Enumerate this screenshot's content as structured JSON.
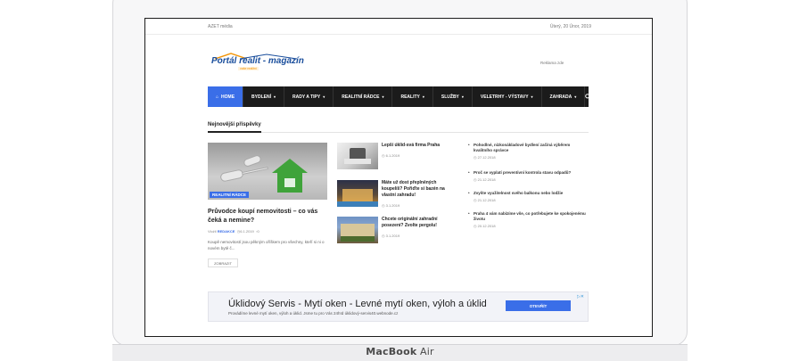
{
  "device": {
    "brand_name": "MacBook",
    "brand_model": "Air"
  },
  "topbar": {
    "left": "AZET média",
    "right": "Úterý, 20 Únor, 2019"
  },
  "header": {
    "logo_text": "Portál realit - magazín",
    "logo_tagline": "vaše realitní",
    "ad_label": "Reklama zde"
  },
  "nav": {
    "items": [
      {
        "label": "HOME",
        "active": true,
        "dropdown": false
      },
      {
        "label": "BYDLENÍ",
        "dropdown": true
      },
      {
        "label": "RADY A TIPY",
        "dropdown": true
      },
      {
        "label": "REALITNÍ RÁDCE",
        "dropdown": true
      },
      {
        "label": "REALITY",
        "dropdown": true
      },
      {
        "label": "SLUŽBY",
        "dropdown": true
      },
      {
        "label": "VELETRHY - VÝSTAVY",
        "dropdown": true
      },
      {
        "label": "ZAHRADA",
        "dropdown": true
      }
    ],
    "search_icon": "search-icon"
  },
  "section": {
    "title": "Nejnovější příspěvky"
  },
  "featured": {
    "badge": "REALITNÍ RÁDCE",
    "title": "Průvodce koupí nemovitosti – co vás čeká a nemine?",
    "author_prefix": "Vložil",
    "author": "REDAKCE",
    "date": "6.1.2019",
    "comments": "0",
    "excerpt": "Koupě nemovitostí jsou pěkným oříškem pro všechny, kteří si ni o novém bytě č...",
    "more_label": "ZOBRAZIT"
  },
  "middle": [
    {
      "title": "Lepší úklid-svá firma Praha",
      "date": "6.1.2019"
    },
    {
      "title": "Máte už dost přeplněných koupelíš? Pořiďte si bazén na vlastní zahradu!",
      "date": "3.1.2019"
    },
    {
      "title": "Chcete originální zahradní posezení? Zvolte pergolu!",
      "date": "3.1.2019"
    }
  ],
  "right": [
    {
      "title": "Pohodlné, nízkonákladové bydlení začíná výběrem kvalitního správce",
      "date": "27.12.2018"
    },
    {
      "title": "Proč se vyplatí preventivní kontrola stavu odpadů?",
      "date": "21.12.2018"
    },
    {
      "title": "Zvyšte využitelnost svého balkonu nebo lodžie",
      "date": "21.12.2018"
    },
    {
      "title": "Praha 4 vám nabízíme vše, co potřebujete ke spokojenému životu",
      "date": "20.12.2018"
    }
  ],
  "ad": {
    "title": "Úklidový Servis - Mytí oken - Levné mytí oken, výloh a úklid",
    "subtitle": "Provádíme levné mytí oken, výloh a úklid. Jsme tu pro Vás 24h!d úklidový-servis40.webnode.cz",
    "button": "OTEVŘÍT",
    "info_icon": "ad-info-icon"
  },
  "colors": {
    "nav_bg": "#1b1b1b",
    "accent": "#3a6ee8",
    "house": "#3fa33a"
  }
}
